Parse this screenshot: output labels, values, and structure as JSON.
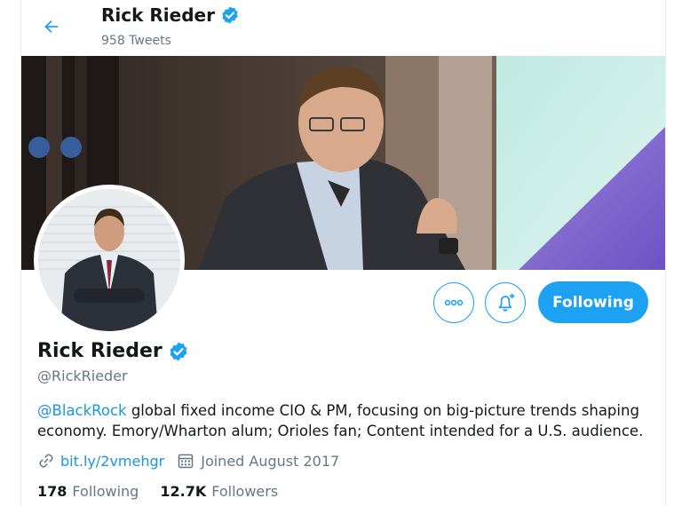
{
  "header": {
    "title": "Rick Rieder",
    "tweet_count": "958 Tweets"
  },
  "profile": {
    "name": "Rick Rieder",
    "handle": "@RickRieder",
    "bio_mention": "@BlackRock",
    "bio_text": " global fixed income CIO & PM, focusing on big-picture trends shaping economy. Emory/Wharton alum; Orioles fan; Content intended for a U.S. audience.",
    "website": "bit.ly/2vmehgr",
    "joined": "Joined August 2017",
    "verified": true
  },
  "actions": {
    "more_icon": "more-dots-icon",
    "notify_icon": "bell-plus-icon",
    "follow_label": "Following"
  },
  "stats": {
    "following_count": "178",
    "following_label": "Following",
    "followers_count": "12.7K",
    "followers_label": "Followers"
  },
  "colors": {
    "accent": "#1da1f2",
    "link": "#1b95e0",
    "muted": "#657786",
    "text": "#14171a"
  }
}
